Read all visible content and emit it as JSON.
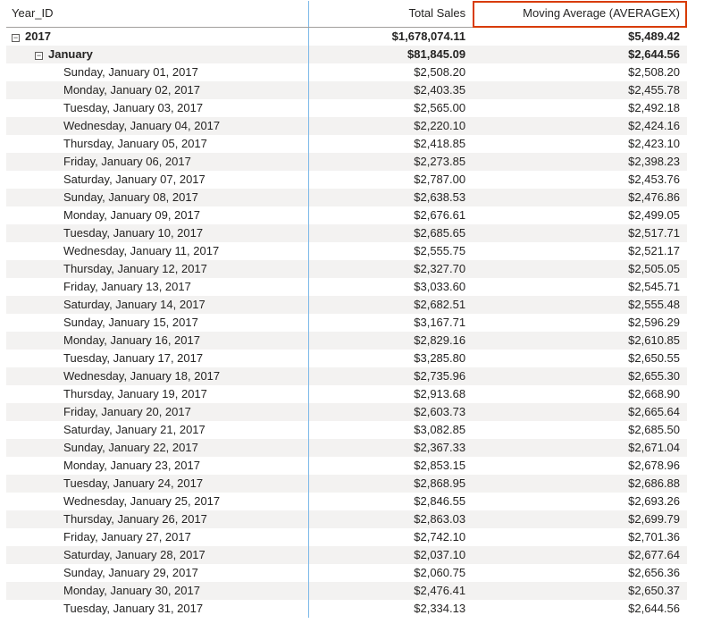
{
  "header": {
    "col_year": "Year_ID",
    "col_sales": "Total Sales",
    "col_mavg": "Moving Average (AVERAGEX)"
  },
  "year": {
    "label": "2017",
    "sales": "$1,678,074.11",
    "mavg": "$5,489.42"
  },
  "month": {
    "label": "January",
    "sales": "$81,845.09",
    "mavg": "$2,644.56"
  },
  "days": [
    {
      "label": "Sunday, January 01, 2017",
      "sales": "$2,508.20",
      "mavg": "$2,508.20"
    },
    {
      "label": "Monday, January 02, 2017",
      "sales": "$2,403.35",
      "mavg": "$2,455.78"
    },
    {
      "label": "Tuesday, January 03, 2017",
      "sales": "$2,565.00",
      "mavg": "$2,492.18"
    },
    {
      "label": "Wednesday, January 04, 2017",
      "sales": "$2,220.10",
      "mavg": "$2,424.16"
    },
    {
      "label": "Thursday, January 05, 2017",
      "sales": "$2,418.85",
      "mavg": "$2,423.10"
    },
    {
      "label": "Friday, January 06, 2017",
      "sales": "$2,273.85",
      "mavg": "$2,398.23"
    },
    {
      "label": "Saturday, January 07, 2017",
      "sales": "$2,787.00",
      "mavg": "$2,453.76"
    },
    {
      "label": "Sunday, January 08, 2017",
      "sales": "$2,638.53",
      "mavg": "$2,476.86"
    },
    {
      "label": "Monday, January 09, 2017",
      "sales": "$2,676.61",
      "mavg": "$2,499.05"
    },
    {
      "label": "Tuesday, January 10, 2017",
      "sales": "$2,685.65",
      "mavg": "$2,517.71"
    },
    {
      "label": "Wednesday, January 11, 2017",
      "sales": "$2,555.75",
      "mavg": "$2,521.17"
    },
    {
      "label": "Thursday, January 12, 2017",
      "sales": "$2,327.70",
      "mavg": "$2,505.05"
    },
    {
      "label": "Friday, January 13, 2017",
      "sales": "$3,033.60",
      "mavg": "$2,545.71"
    },
    {
      "label": "Saturday, January 14, 2017",
      "sales": "$2,682.51",
      "mavg": "$2,555.48"
    },
    {
      "label": "Sunday, January 15, 2017",
      "sales": "$3,167.71",
      "mavg": "$2,596.29"
    },
    {
      "label": "Monday, January 16, 2017",
      "sales": "$2,829.16",
      "mavg": "$2,610.85"
    },
    {
      "label": "Tuesday, January 17, 2017",
      "sales": "$3,285.80",
      "mavg": "$2,650.55"
    },
    {
      "label": "Wednesday, January 18, 2017",
      "sales": "$2,735.96",
      "mavg": "$2,655.30"
    },
    {
      "label": "Thursday, January 19, 2017",
      "sales": "$2,913.68",
      "mavg": "$2,668.90"
    },
    {
      "label": "Friday, January 20, 2017",
      "sales": "$2,603.73",
      "mavg": "$2,665.64"
    },
    {
      "label": "Saturday, January 21, 2017",
      "sales": "$3,082.85",
      "mavg": "$2,685.50"
    },
    {
      "label": "Sunday, January 22, 2017",
      "sales": "$2,367.33",
      "mavg": "$2,671.04"
    },
    {
      "label": "Monday, January 23, 2017",
      "sales": "$2,853.15",
      "mavg": "$2,678.96"
    },
    {
      "label": "Tuesday, January 24, 2017",
      "sales": "$2,868.95",
      "mavg": "$2,686.88"
    },
    {
      "label": "Wednesday, January 25, 2017",
      "sales": "$2,846.55",
      "mavg": "$2,693.26"
    },
    {
      "label": "Thursday, January 26, 2017",
      "sales": "$2,863.03",
      "mavg": "$2,699.79"
    },
    {
      "label": "Friday, January 27, 2017",
      "sales": "$2,742.10",
      "mavg": "$2,701.36"
    },
    {
      "label": "Saturday, January 28, 2017",
      "sales": "$2,037.10",
      "mavg": "$2,677.64"
    },
    {
      "label": "Sunday, January 29, 2017",
      "sales": "$2,060.75",
      "mavg": "$2,656.36"
    },
    {
      "label": "Monday, January 30, 2017",
      "sales": "$2,476.41",
      "mavg": "$2,650.37"
    },
    {
      "label": "Tuesday, January 31, 2017",
      "sales": "$2,334.13",
      "mavg": "$2,644.56"
    }
  ],
  "icons": {
    "collapse_minus": "−"
  }
}
